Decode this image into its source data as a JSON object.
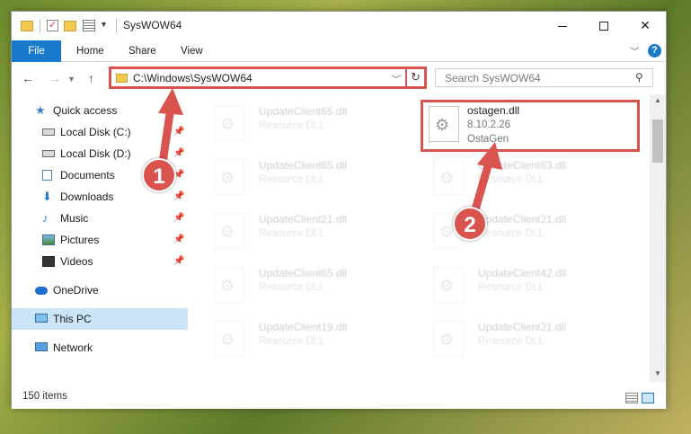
{
  "window": {
    "title": "SysWOW64"
  },
  "ribbon": {
    "tabs": [
      "File",
      "Home",
      "Share",
      "View"
    ]
  },
  "address_bar": {
    "path": "C:\\Windows\\SysWOW64"
  },
  "search": {
    "placeholder": "Search SysWOW64"
  },
  "sidebar": {
    "items": [
      {
        "label": "Quick access",
        "icon": "star-icon",
        "pinned": false
      },
      {
        "label": "Local Disk (C:)",
        "icon": "disk-icon",
        "pinned": true
      },
      {
        "label": "Local Disk (D:)",
        "icon": "disk-icon",
        "pinned": true
      },
      {
        "label": "Documents",
        "icon": "documents-icon",
        "pinned": true
      },
      {
        "label": "Downloads",
        "icon": "download-icon",
        "pinned": true
      },
      {
        "label": "Music",
        "icon": "music-icon",
        "pinned": true
      },
      {
        "label": "Pictures",
        "icon": "pictures-icon",
        "pinned": true
      },
      {
        "label": "Videos",
        "icon": "videos-icon",
        "pinned": true
      },
      {
        "label": "OneDrive",
        "icon": "onedrive-icon",
        "pinned": false
      },
      {
        "label": "This PC",
        "icon": "pc-icon",
        "pinned": false,
        "selected": true
      },
      {
        "label": "Network",
        "icon": "network-icon",
        "pinned": false
      }
    ]
  },
  "files": {
    "highlighted": {
      "name": "ostagen.dll",
      "version": "8.10.2.26",
      "company": "OstaGen"
    },
    "faded": [
      {
        "name": "UpdateClient65.dll",
        "type": "Resource DLL"
      },
      {
        "name": "UpdateClient65.dll",
        "type": "Resource DLL"
      },
      {
        "name": "UpdateClient63.dll",
        "type": "Resource DLL"
      },
      {
        "name": "UpdateClient21.dll",
        "type": "Resource DLL"
      },
      {
        "name": "UpdateClient21.dll",
        "type": "Resource DLL"
      },
      {
        "name": "UpdateClient65.dll",
        "type": "Resource DLL"
      },
      {
        "name": "UpdateClient42.dll",
        "type": "Resource DLL"
      },
      {
        "name": "UpdateClient19.dll",
        "type": "Resource DLL"
      },
      {
        "name": "UpdateClient21.dll",
        "type": "Resource DLL"
      }
    ]
  },
  "status": {
    "item_count": "150 items"
  },
  "annotations": {
    "step1": "1",
    "step2": "2",
    "color": "#d9534f"
  }
}
